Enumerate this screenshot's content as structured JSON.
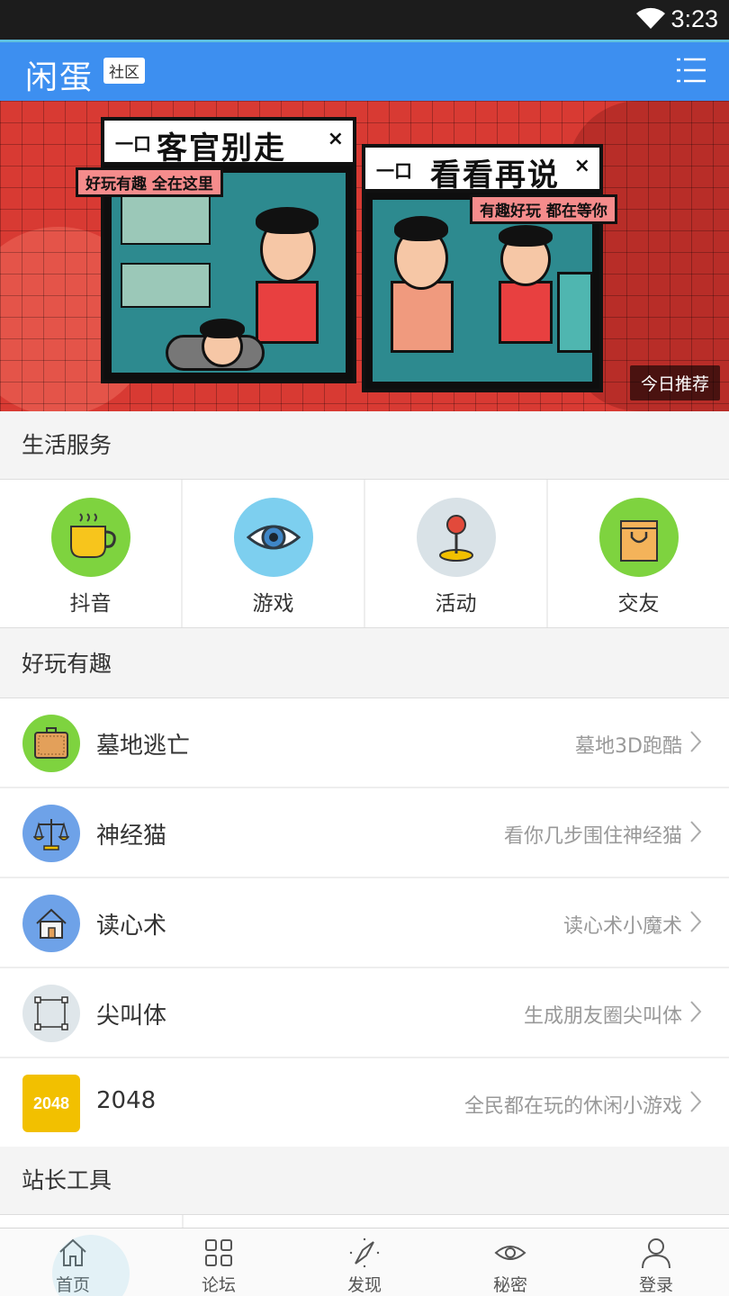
{
  "status_bar": {
    "time": "3:23",
    "wifi_icon": "wifi-icon"
  },
  "header": {
    "logo": "闲蛋",
    "badge": "社区",
    "menu_icon": "menu-icon"
  },
  "banner": {
    "panel_left": {
      "title": "客官别走",
      "tag": "好玩有趣 全在这里",
      "window_controls": "一口",
      "close": "×"
    },
    "panel_right": {
      "title": "看看再说",
      "tag": "有趣好玩 都在等你",
      "window_controls": "一口",
      "close": "×"
    },
    "overlay_label": "今日推荐"
  },
  "services_section": {
    "title": "生活服务",
    "items": [
      {
        "label": "抖音",
        "icon": "coffee-cup-icon",
        "color": "#7ed33f"
      },
      {
        "label": "游戏",
        "icon": "eye-icon",
        "color": "#7dcfef"
      },
      {
        "label": "活动",
        "icon": "joystick-icon",
        "color": "#d9e2e7"
      },
      {
        "label": "交友",
        "icon": "shopping-bag-icon",
        "color": "#7ed33f"
      }
    ]
  },
  "fun_section": {
    "title": "好玩有趣",
    "items": [
      {
        "name": "墓地逃亡",
        "desc": "墓地3D跑酷",
        "icon": "suitcase-icon",
        "color": "#7ed33f"
      },
      {
        "name": "神经猫",
        "desc": "看你几步围住神经猫",
        "icon": "scales-icon",
        "color": "#6ea2e8"
      },
      {
        "name": "读心术",
        "desc": "读心术小魔术",
        "icon": "house-icon",
        "color": "#6ea2e8"
      },
      {
        "name": "尖叫体",
        "desc": "生成朋友圈尖叫体",
        "icon": "selection-box-icon",
        "color": "#dfe6ea"
      },
      {
        "name": "2048",
        "desc": "全民都在玩的休闲小游戏",
        "icon": "2048",
        "color": "#f2c000"
      }
    ]
  },
  "tools_section": {
    "title": "站长工具"
  },
  "bottom_nav": [
    {
      "label": "首页",
      "icon": "home-icon"
    },
    {
      "label": "论坛",
      "icon": "grid-icon"
    },
    {
      "label": "发现",
      "icon": "compass-icon"
    },
    {
      "label": "秘密",
      "icon": "eye-icon"
    },
    {
      "label": "登录",
      "icon": "user-icon"
    }
  ],
  "colors": {
    "primary": "#3d8ff0",
    "status_bar": "#1c1c1c",
    "banner_red": "#d83a33"
  }
}
